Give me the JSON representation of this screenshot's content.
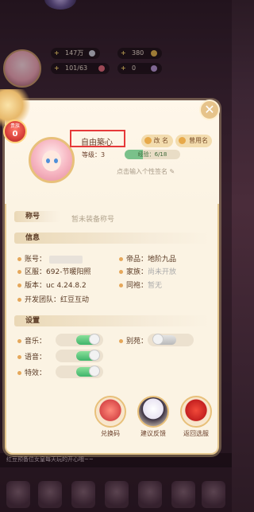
{
  "hud": {
    "res1_value": "147万",
    "res2_value": "380",
    "res3_value": "101/63",
    "res4_value": "0"
  },
  "vip": {
    "label": "贵族",
    "level": "0"
  },
  "profile": {
    "name": "自由築心",
    "rename_label": "改 名",
    "used_names_label": "曾用名",
    "level_label": "等级：3",
    "exp_text": "经验：6/18",
    "exp_progress": 0.333,
    "signature_placeholder": "点击输入个性签名"
  },
  "sections": {
    "title_header": "称号",
    "title_value": "暂未装备称号",
    "info_header": "信息",
    "settings_header": "设置"
  },
  "info": {
    "account_label": "账号：",
    "server_label": "区服：",
    "server_value": "692-节暖阳照",
    "version_label": "版本：",
    "version_value": "uc 4.24.8.2",
    "dev_label": "开发团队：",
    "dev_value": "红豆互动",
    "rank_label": "帝品：",
    "rank_value": "地阶九品",
    "family_label": "家族：",
    "family_value": "尚未开放",
    "partner_label": "同袍：",
    "partner_value": "暂无"
  },
  "settings": {
    "music_label": "音乐：",
    "music_on": true,
    "voice_label": "语音：",
    "voice_on": true,
    "effects_label": "特效：",
    "effects_on": true,
    "villa_label": "别苑：",
    "villa_on": false
  },
  "buttons": {
    "redeem": "兑换码",
    "feedback": "建议反馈",
    "back_select": "返回选服"
  },
  "chat": {
    "text": "红豆预备位女皇每天玩的开心哦~~"
  },
  "colors": {
    "accent_gold": "#e6c88f",
    "toggle_on": "#3fb46a",
    "highlight_red": "#e63a3a"
  }
}
